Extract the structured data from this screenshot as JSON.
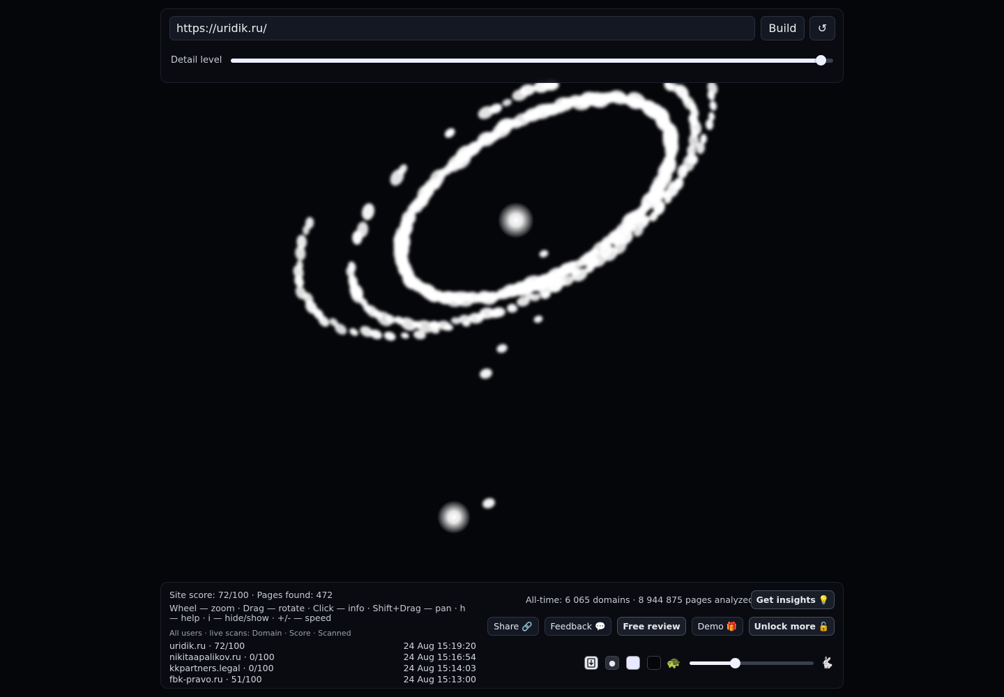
{
  "colors": {
    "background": "#05060a",
    "particle": "#ffffff",
    "panel": "#0a0c12",
    "accent": "#eef0ff"
  },
  "toolbar": {
    "url_value": "https://uridik.ru/",
    "build_label": "Build",
    "reset_label": "↺",
    "detail_label": "Detail level",
    "detail_level": 0.98
  },
  "stats": {
    "site_score": "Site score: 72/100 · Pages found: 472",
    "help": "Wheel — zoom · Drag — rotate · Click — info · Shift+Drag — pan · h — help · i — hide/show · +/- — speed",
    "live_header": "All users · live scans: Domain · Score · Scanned",
    "scans": [
      {
        "domain": "uridik.ru · 72/100",
        "time": "24 Aug 15:19:20"
      },
      {
        "domain": "nikitaapalikov.ru · 0/100",
        "time": "24 Aug 15:16:54"
      },
      {
        "domain": "kkpartners.legal · 0/100",
        "time": "24 Aug 15:14:03"
      },
      {
        "domain": "fbk-pravo.ru · 51/100",
        "time": "24 Aug 15:13:00"
      }
    ],
    "alltime": "All-time: 6 065 domains · 8 944 875 pages analyzed"
  },
  "actions": {
    "insights": {
      "label": "Get insights",
      "icon": "💡"
    },
    "share": {
      "label": "Share",
      "icon": "🔗"
    },
    "feedback": {
      "label": "Feedback",
      "icon": "💬"
    },
    "review": {
      "label": "Free review"
    },
    "demo": {
      "label": "Demo",
      "icon": "🎁"
    },
    "unlock": {
      "label": "Unlock more",
      "icon": "🔓"
    }
  },
  "controls": {
    "export_icon": "download-icon",
    "dot_icon": "●",
    "slow_icon": "🐢",
    "fast_icon": "🐇",
    "speed_level": 0.37
  }
}
